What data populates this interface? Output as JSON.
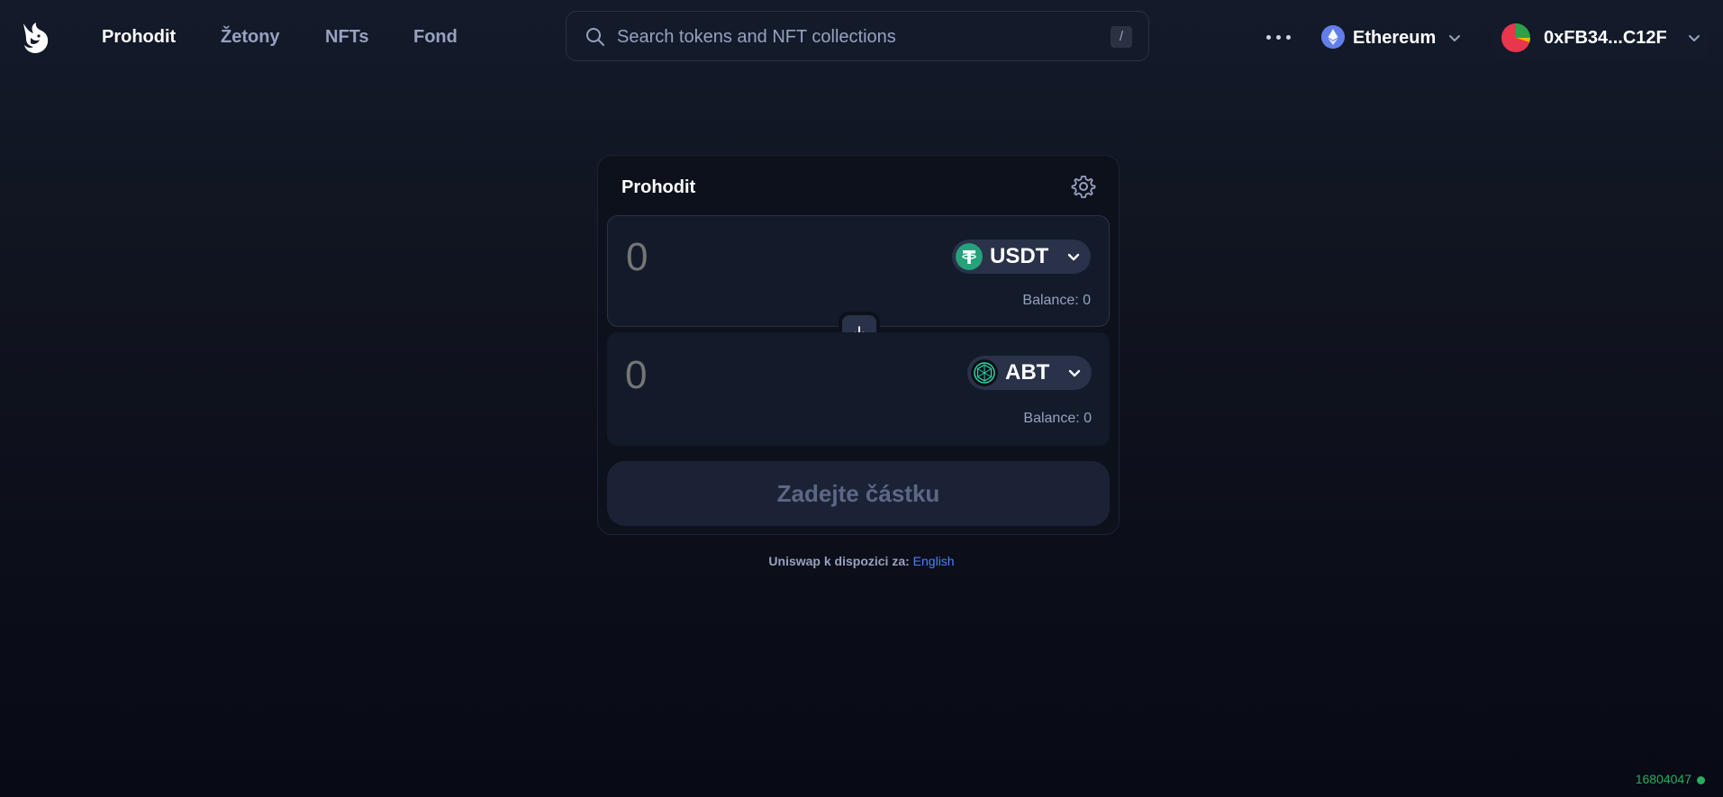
{
  "nav": {
    "logo_icon": "uniswap-unicorn-logo",
    "links": [
      {
        "label": "Prohodit",
        "active": true
      },
      {
        "label": "Žetony",
        "active": false
      },
      {
        "label": "NFTs",
        "active": false
      },
      {
        "label": "Fond",
        "active": false
      }
    ],
    "search": {
      "placeholder": "Search tokens and NFT collections",
      "shortcut": "/"
    },
    "more_icon": "ellipsis-icon",
    "network": {
      "label": "Ethereum",
      "icon": "ethereum-icon"
    },
    "account": {
      "label": "0xFB34...C12F",
      "icon": "wallet-avatar"
    }
  },
  "swap": {
    "title": "Prohodit",
    "settings_icon": "gear-icon",
    "input": {
      "amount": "0",
      "token": "USDT",
      "token_icon": "tether-icon",
      "balance": "Balance: 0"
    },
    "output": {
      "amount": "0",
      "token": "ABT",
      "token_icon": "abt-token-icon",
      "balance": "Balance: 0"
    },
    "switch_icon": "arrow-down-icon",
    "cta_label": "Zadejte částku"
  },
  "footer": {
    "lang_text": "Uniswap k dispozici za:",
    "lang_link": "English",
    "block_number": "16804047"
  },
  "colors": {
    "background": "#0d111c",
    "panel": "#131a2a",
    "muted_text": "#98a1c0",
    "accent": "#4c82fb",
    "status_green": "#27ae60",
    "usdt_green": "#26a17b"
  }
}
